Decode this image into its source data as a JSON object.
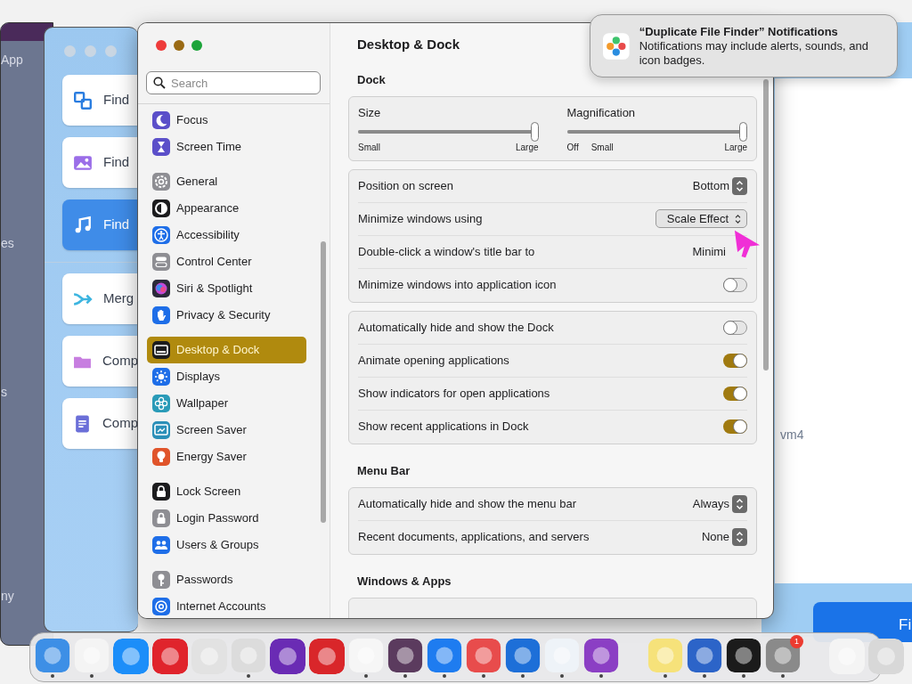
{
  "left_app": {
    "texts": [
      "App",
      "es",
      "s",
      "ny"
    ]
  },
  "blue_app": {
    "cards": [
      {
        "label": "Find",
        "kind": "squares",
        "selected": false
      },
      {
        "label": "Find",
        "kind": "image",
        "selected": false
      },
      {
        "label": "Find",
        "kind": "music",
        "selected": true
      },
      {
        "label": "Merg",
        "kind": "merge",
        "selected": false
      },
      {
        "label": "Comp",
        "kind": "folder",
        "selected": false
      },
      {
        "label": "Comp",
        "kind": "document",
        "selected": false
      }
    ]
  },
  "right_app": {
    "text": "vm4",
    "button": "Fi"
  },
  "settings": {
    "search": {
      "placeholder": "Search"
    },
    "sidebar": {
      "groups": [
        {
          "items": [
            {
              "label": "Focus",
              "kind": "moon",
              "color": "#5b4fc9",
              "selected": false
            },
            {
              "label": "Screen Time",
              "kind": "hourglass",
              "color": "#5b4fc9",
              "selected": false
            }
          ]
        },
        {
          "items": [
            {
              "label": "General",
              "kind": "gear",
              "color": "#8e8e93",
              "selected": false
            },
            {
              "label": "Appearance",
              "kind": "contrast",
              "color": "#1c1c1e",
              "selected": false
            },
            {
              "label": "Accessibility",
              "kind": "person",
              "color": "#1e6ee8",
              "selected": false
            },
            {
              "label": "Control Center",
              "kind": "switches",
              "color": "#8e8e93",
              "selected": false
            },
            {
              "label": "Siri & Spotlight",
              "kind": "orb",
              "color": "#2a2a3a",
              "selected": false
            },
            {
              "label": "Privacy & Security",
              "kind": "hand",
              "color": "#1e6ee8",
              "selected": false
            }
          ]
        },
        {
          "items": [
            {
              "label": "Desktop & Dock",
              "kind": "window",
              "color": "#1c1c1e",
              "selected": true
            },
            {
              "label": "Displays",
              "kind": "sun",
              "color": "#1e6ee8",
              "selected": false
            },
            {
              "label": "Wallpaper",
              "kind": "flower",
              "color": "#2a9bb8",
              "selected": false
            },
            {
              "label": "Screen Saver",
              "kind": "screen",
              "color": "#2a8fb8",
              "selected": false
            },
            {
              "label": "Energy Saver",
              "kind": "bulb",
              "color": "#e0542a",
              "selected": false
            }
          ]
        },
        {
          "items": [
            {
              "label": "Lock Screen",
              "kind": "lock",
              "color": "#1c1c1e",
              "selected": false
            },
            {
              "label": "Login Password",
              "kind": "padlock",
              "color": "#8e8e93",
              "selected": false
            },
            {
              "label": "Users & Groups",
              "kind": "people",
              "color": "#1e6ee8",
              "selected": false
            }
          ]
        },
        {
          "items": [
            {
              "label": "Passwords",
              "kind": "key",
              "color": "#8e8e93",
              "selected": false
            },
            {
              "label": "Internet Accounts",
              "kind": "at",
              "color": "#1e6ee8",
              "selected": false
            }
          ]
        }
      ]
    },
    "title": "Desktop & Dock",
    "sections": [
      {
        "heading": "Dock",
        "cards": [
          {
            "kind": "sliders",
            "sliders": [
              {
                "label": "Size",
                "level": 1,
                "labels": [
                  "Small",
                  "Large"
                ]
              },
              {
                "label": "Magnification",
                "level": 1,
                "labels": [
                  "Off",
                  "Small",
                  "Large"
                ]
              }
            ]
          },
          {
            "kind": "rows",
            "rows": [
              {
                "label": "Position on screen",
                "kind": "stepper",
                "value": "Bottom"
              },
              {
                "label": "Minimize windows using",
                "kind": "popup",
                "value": "Scale Effect"
              },
              {
                "label": "Double-click a window's title bar to",
                "kind": "value",
                "value": "Minimi"
              },
              {
                "label": "Minimize windows into application icon",
                "kind": "toggle",
                "on": false
              }
            ]
          },
          {
            "kind": "rows",
            "rows": [
              {
                "label": "Automatically hide and show the Dock",
                "kind": "toggle",
                "on": false
              },
              {
                "label": "Animate opening applications",
                "kind": "toggle",
                "on": true
              },
              {
                "label": "Show indicators for open applications",
                "kind": "toggle",
                "on": true
              },
              {
                "label": "Show recent applications in Dock",
                "kind": "toggle",
                "on": true
              }
            ]
          }
        ]
      },
      {
        "heading": "Menu Bar",
        "cards": [
          {
            "kind": "rows",
            "rows": [
              {
                "label": "Automatically hide and show the menu bar",
                "kind": "stepper",
                "value": "Always"
              },
              {
                "label": "Recent documents, applications, and servers",
                "kind": "stepper",
                "value": "None"
              }
            ]
          }
        ]
      },
      {
        "heading": "Windows & Apps",
        "cards": [
          {
            "kind": "cut"
          }
        ]
      }
    ]
  },
  "notification": {
    "title": "“Duplicate File Finder” Notifications",
    "body": "Notifications may include alerts, sounds, and icon badges."
  },
  "dock": {
    "groups": [
      {
        "items": [
          {
            "color": "#3d8fe6",
            "running": true
          },
          {
            "color": "#f4f4f4",
            "running": true
          },
          {
            "color": "#1c8ef9",
            "running": false
          },
          {
            "color": "#e0242c",
            "running": false
          },
          {
            "color": "#e2e2e2",
            "running": false
          },
          {
            "color": "#dcdcdc",
            "running": true
          },
          {
            "color": "#6a2bb4",
            "running": false
          },
          {
            "color": "#d9262a",
            "running": false
          },
          {
            "color": "#f6f6f6",
            "running": true
          },
          {
            "color": "#5b3b5e",
            "running": true
          },
          {
            "color": "#1e7cf0",
            "running": true
          },
          {
            "color": "#e84c4c",
            "running": true
          },
          {
            "color": "#1d6fd8",
            "running": true
          },
          {
            "color": "#eef3f8",
            "running": true
          },
          {
            "color": "#8b3fc4",
            "running": true
          }
        ]
      },
      {
        "items": [
          {
            "color": "#f6e27a",
            "running": true
          },
          {
            "color": "#2c64c8",
            "running": true
          },
          {
            "color": "#1b1b1b",
            "running": true
          },
          {
            "color": "#8a8a8a",
            "running": true,
            "badge": "1"
          }
        ]
      },
      {
        "items": [
          {
            "color": "#f4f4f4",
            "running": false
          },
          {
            "color": "#d8d8d8",
            "running": false
          }
        ]
      }
    ]
  }
}
